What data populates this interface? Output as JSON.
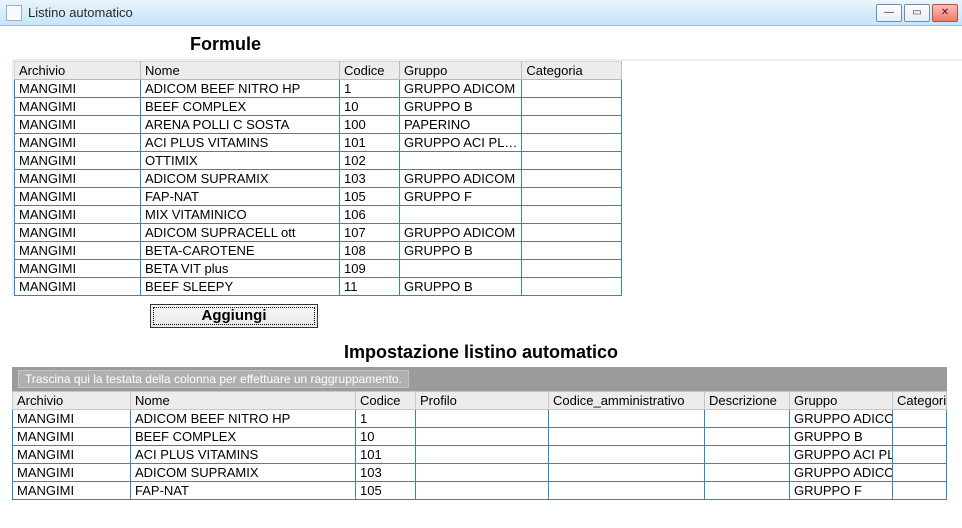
{
  "window": {
    "title": "Listino automatico"
  },
  "formule": {
    "title": "Formule",
    "headers": [
      "Archivio",
      "Nome",
      "Codice",
      "Gruppo",
      "Categoria"
    ],
    "rows": [
      {
        "archivio": "MANGIMI",
        "nome": "ADICOM BEEF NITRO HP",
        "codice": "1",
        "gruppo": "GRUPPO ADICOM",
        "categoria": ""
      },
      {
        "archivio": "MANGIMI",
        "nome": "BEEF COMPLEX",
        "codice": "10",
        "gruppo": "GRUPPO B",
        "categoria": ""
      },
      {
        "archivio": "MANGIMI",
        "nome": "ARENA POLLI C SOSTA",
        "codice": "100",
        "gruppo": "PAPERINO",
        "categoria": ""
      },
      {
        "archivio": "MANGIMI",
        "nome": "ACI PLUS VITAMINS",
        "codice": "101",
        "gruppo": "GRUPPO ACI PL…",
        "categoria": ""
      },
      {
        "archivio": "MANGIMI",
        "nome": "OTTIMIX",
        "codice": "102",
        "gruppo": "",
        "categoria": ""
      },
      {
        "archivio": "MANGIMI",
        "nome": "ADICOM SUPRAMIX",
        "codice": "103",
        "gruppo": "GRUPPO ADICOM",
        "categoria": ""
      },
      {
        "archivio": "MANGIMI",
        "nome": "FAP-NAT",
        "codice": "105",
        "gruppo": "GRUPPO F",
        "categoria": ""
      },
      {
        "archivio": "MANGIMI",
        "nome": "MIX VITAMINICO",
        "codice": "106",
        "gruppo": "",
        "categoria": ""
      },
      {
        "archivio": "MANGIMI",
        "nome": "ADICOM SUPRACELL ott",
        "codice": "107",
        "gruppo": "GRUPPO ADICOM",
        "categoria": ""
      },
      {
        "archivio": "MANGIMI",
        "nome": "BETA-CAROTENE",
        "codice": "108",
        "gruppo": "GRUPPO B",
        "categoria": ""
      },
      {
        "archivio": "MANGIMI",
        "nome": "BETA VIT plus",
        "codice": "109",
        "gruppo": "",
        "categoria": ""
      },
      {
        "archivio": "MANGIMI",
        "nome": "BEEF SLEEPY",
        "codice": "11",
        "gruppo": "GRUPPO B",
        "categoria": ""
      }
    ]
  },
  "add_button": "Aggiungi",
  "listino": {
    "title": "Impostazione listino automatico",
    "group_hint": "Trascina qui la testata della colonna per effettuare un raggruppamento.",
    "headers": [
      "Archivio",
      "Nome",
      "Codice",
      "Profilo",
      "Codice_amministrativo",
      "Descrizione",
      "Gruppo",
      "Categoria"
    ],
    "rows": [
      {
        "archivio": "MANGIMI",
        "nome": "ADICOM BEEF NITRO HP",
        "codice": "1",
        "profilo": "",
        "codamm": "",
        "descr": "",
        "gruppo": "GRUPPO ADICOM",
        "categoria": ""
      },
      {
        "archivio": "MANGIMI",
        "nome": "BEEF COMPLEX",
        "codice": "10",
        "profilo": "",
        "codamm": "",
        "descr": "",
        "gruppo": "GRUPPO B",
        "categoria": ""
      },
      {
        "archivio": "MANGIMI",
        "nome": "ACI PLUS VITAMINS",
        "codice": "101",
        "profilo": "",
        "codamm": "",
        "descr": "",
        "gruppo": "GRUPPO ACI PL…",
        "categoria": ""
      },
      {
        "archivio": "MANGIMI",
        "nome": "ADICOM SUPRAMIX",
        "codice": "103",
        "profilo": "",
        "codamm": "",
        "descr": "",
        "gruppo": "GRUPPO ADICOM",
        "categoria": ""
      },
      {
        "archivio": "MANGIMI",
        "nome": "FAP-NAT",
        "codice": "105",
        "profilo": "",
        "codamm": "",
        "descr": "",
        "gruppo": "GRUPPO F",
        "categoria": ""
      }
    ]
  }
}
